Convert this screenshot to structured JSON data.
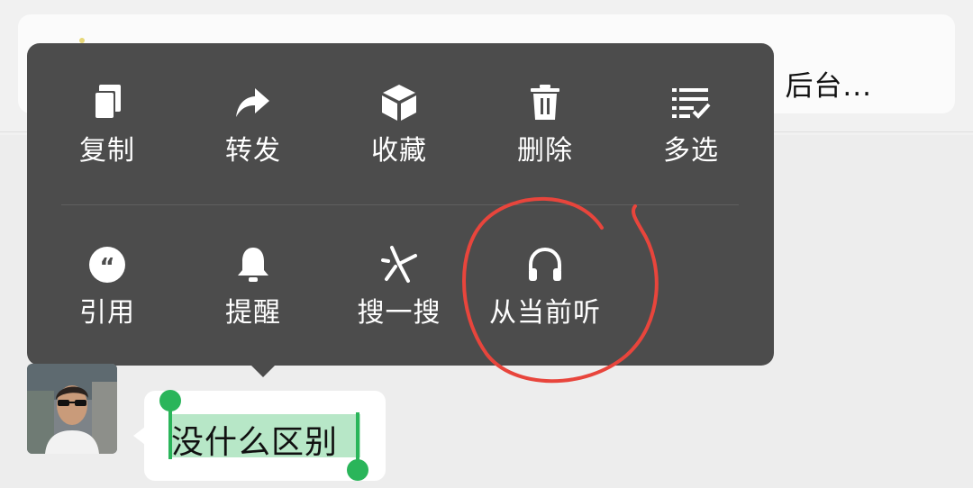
{
  "background_card": {
    "visible_text": "后台..."
  },
  "context_menu": {
    "row1": [
      {
        "icon": "copy-icon",
        "label": "复制"
      },
      {
        "icon": "forward-icon",
        "label": "转发"
      },
      {
        "icon": "favorite-box-icon",
        "label": "收藏"
      },
      {
        "icon": "trash-icon",
        "label": "删除"
      },
      {
        "icon": "multi-select-icon",
        "label": "多选"
      }
    ],
    "row2": [
      {
        "icon": "quote-icon",
        "label": "引用"
      },
      {
        "icon": "bell-icon",
        "label": "提醒"
      },
      {
        "icon": "search-one-icon",
        "label": "搜一搜"
      },
      {
        "icon": "headphones-icon",
        "label": "从当前听"
      }
    ]
  },
  "annotation": {
    "color": "#e8453c",
    "target": "从当前听"
  },
  "message": {
    "text": "没什么区别",
    "selected": true,
    "selection_color": "#b7e7c7",
    "handle_color": "#2ab55a"
  },
  "colors": {
    "menu_background": "#4c4c4c",
    "menu_text": "#ffffff",
    "page_background": "#ededed",
    "bubble_background": "#ffffff"
  }
}
